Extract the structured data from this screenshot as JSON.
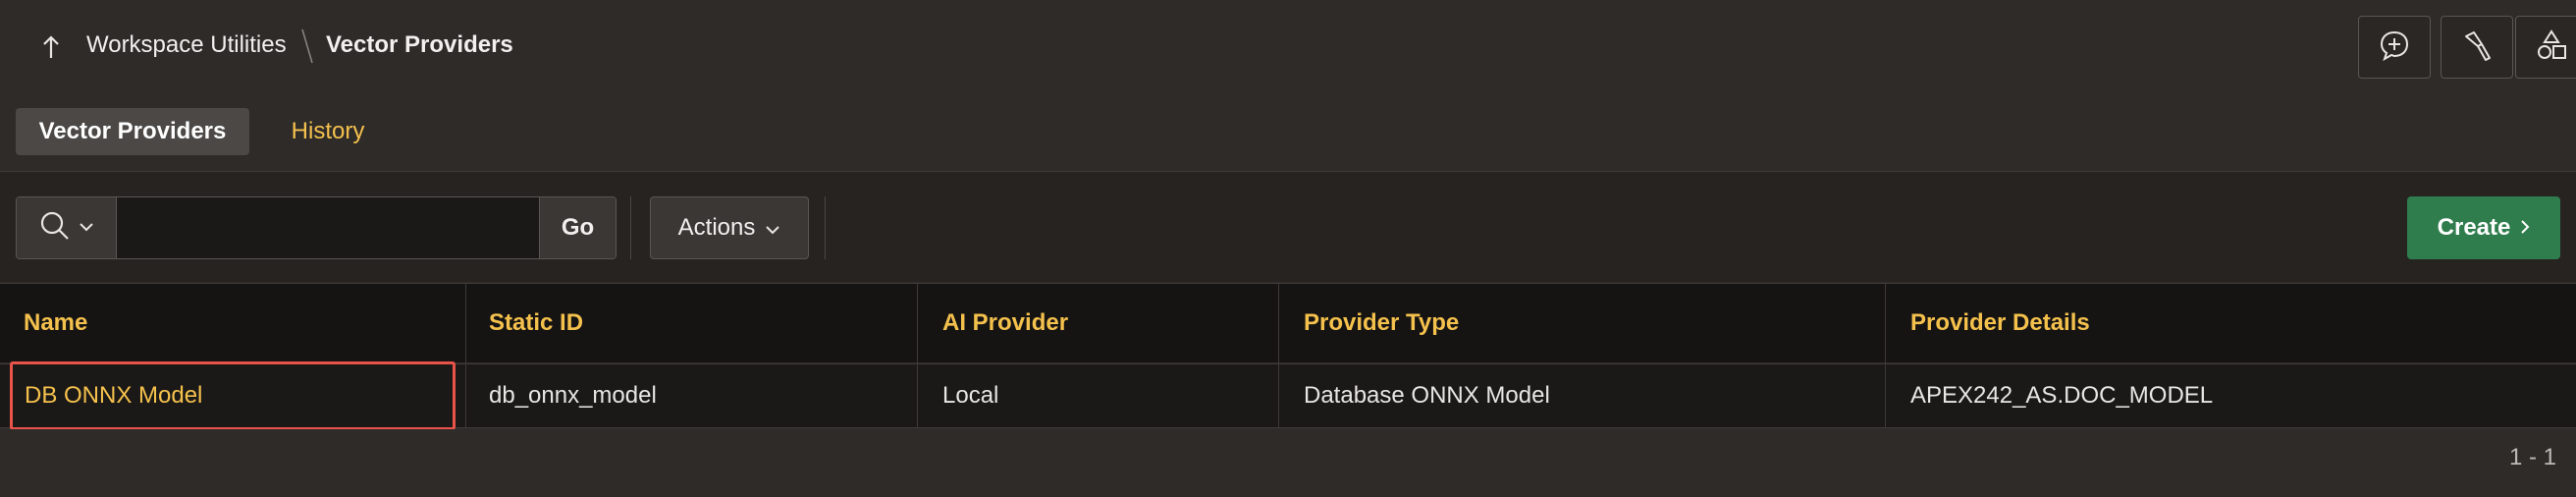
{
  "breadcrumb": {
    "parent": "Workspace Utilities",
    "current": "Vector Providers"
  },
  "header_tools": [
    {
      "icon": "chat-plus-icon"
    },
    {
      "icon": "flashlight-icon"
    },
    {
      "icon": "shapes-icon"
    }
  ],
  "tabs": [
    {
      "label": "Vector Providers",
      "active": true
    },
    {
      "label": "History",
      "active": false
    }
  ],
  "toolbar": {
    "search_value": "",
    "search_placeholder": "",
    "go_label": "Go",
    "actions_label": "Actions",
    "create_label": "Create"
  },
  "table": {
    "columns": [
      "Name",
      "Static ID",
      "AI Provider",
      "Provider Type",
      "Provider Details"
    ],
    "rows": [
      [
        "DB ONNX Model",
        "db_onnx_model",
        "Local",
        "Database ONNX Model",
        "APEX242_AS.DOC_MODEL"
      ]
    ]
  },
  "pagination": "1 - 1",
  "colors": {
    "background": "#2e2b29",
    "link": "#f5c14d",
    "create": "#2f7d4d",
    "highlight": "#e8534a"
  }
}
